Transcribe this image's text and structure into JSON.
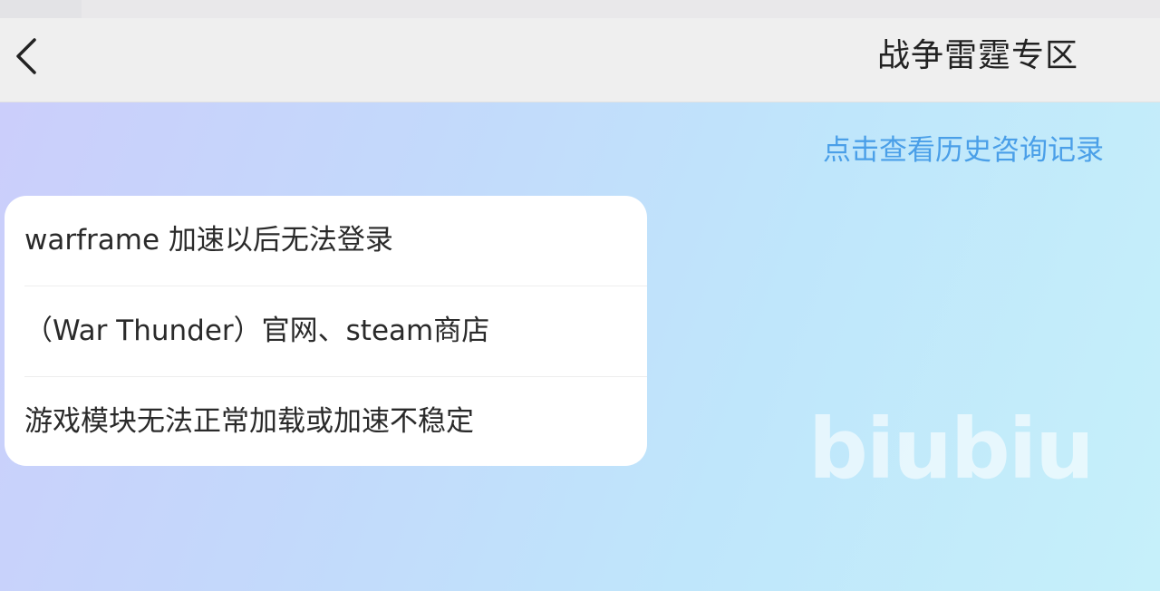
{
  "header": {
    "back_icon": "chevron-left-icon",
    "title": "战争雷霆专区"
  },
  "history_link": {
    "label": "点击查看历史咨询记录",
    "color": "#4a9fe8"
  },
  "faq": {
    "items": [
      {
        "label": "warframe 加速以后无法登录"
      },
      {
        "label": "（War Thunder）官网、steam商店"
      },
      {
        "label": "游戏模块无法正常加载或加速不稳定"
      }
    ]
  },
  "watermark": {
    "text": "biubiu"
  }
}
